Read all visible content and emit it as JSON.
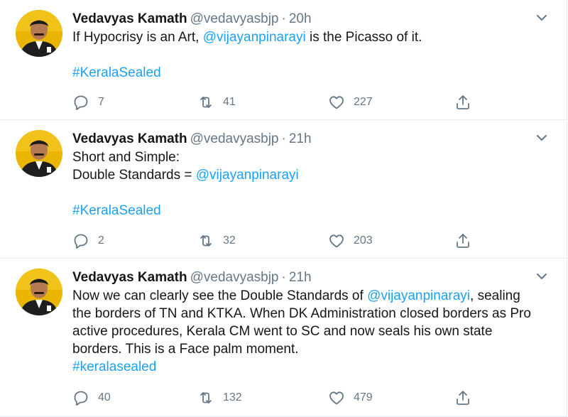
{
  "tweets": [
    {
      "author": "Vedavyas Kamath",
      "handle": "@vedavyasbjp",
      "sep": "·",
      "time": "20h",
      "line1_a": "If Hypocrisy is an Art, ",
      "line1_mention": "@vijayanpinarayi",
      "line1_b": " is the Picasso of it.",
      "hashtag": "#KeralaSealed",
      "replies": "7",
      "retweets": "41",
      "likes": "227"
    },
    {
      "author": "Vedavyas Kamath",
      "handle": "@vedavyasbjp",
      "sep": "·",
      "time": "21h",
      "line1": "Short and Simple:",
      "line2_a": "Double Standards = ",
      "line2_mention": "@vijayanpinarayi",
      "hashtag": "#KeralaSealed",
      "replies": "2",
      "retweets": "32",
      "likes": "203"
    },
    {
      "author": "Vedavyas Kamath",
      "handle": "@vedavyasbjp",
      "sep": "·",
      "time": "21h",
      "line1_a": "Now we can clearly see the Double Standards of ",
      "line1_mention": "@vijayanpinarayi",
      "line1_b": ", sealing",
      "line2": "the borders of TN and KTKA. When DK Administration closed borders as Pro",
      "line3": "active procedures, Kerala CM went to SC and now seals his own state",
      "line4": "borders. This is a Face palm moment.",
      "hashtag": "#keralasealed",
      "replies": "40",
      "retweets": "132",
      "likes": "479"
    }
  ],
  "icons": {
    "reply": "reply-icon",
    "retweet": "retweet-icon",
    "like": "heart-icon",
    "share": "share-icon",
    "caret": "chevron-down-icon"
  },
  "colors": {
    "link": "#1da1f2",
    "muted": "#657786",
    "text": "#14171a",
    "border": "#e6ecf0"
  }
}
